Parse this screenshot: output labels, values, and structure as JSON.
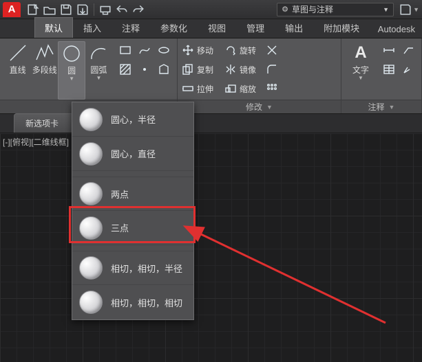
{
  "qat": {
    "workspace_label": "草图与注释"
  },
  "ribbon_tabs": [
    "默认",
    "插入",
    "注释",
    "参数化",
    "视图",
    "管理",
    "输出",
    "附加模块"
  ],
  "brand": "Autodesk",
  "draw_panel": {
    "line": "直线",
    "polyline": "多段线",
    "circle": "圆",
    "arc": "圆弧"
  },
  "modify_panel": {
    "title": "修改",
    "move": "移动",
    "copy": "复制",
    "stretch": "拉伸",
    "rotate": "旋转",
    "mirror": "镜像",
    "scale": "缩放"
  },
  "annotate_panel": {
    "title": "注释",
    "text": "文字"
  },
  "circle_menu": [
    "圆心，半径",
    "圆心，直径",
    "两点",
    "三点",
    "相切，相切，半径",
    "相切，相切，相切"
  ],
  "doc_tab": "新选项卡",
  "viewport_state": "[-][俯视][二维线框]"
}
